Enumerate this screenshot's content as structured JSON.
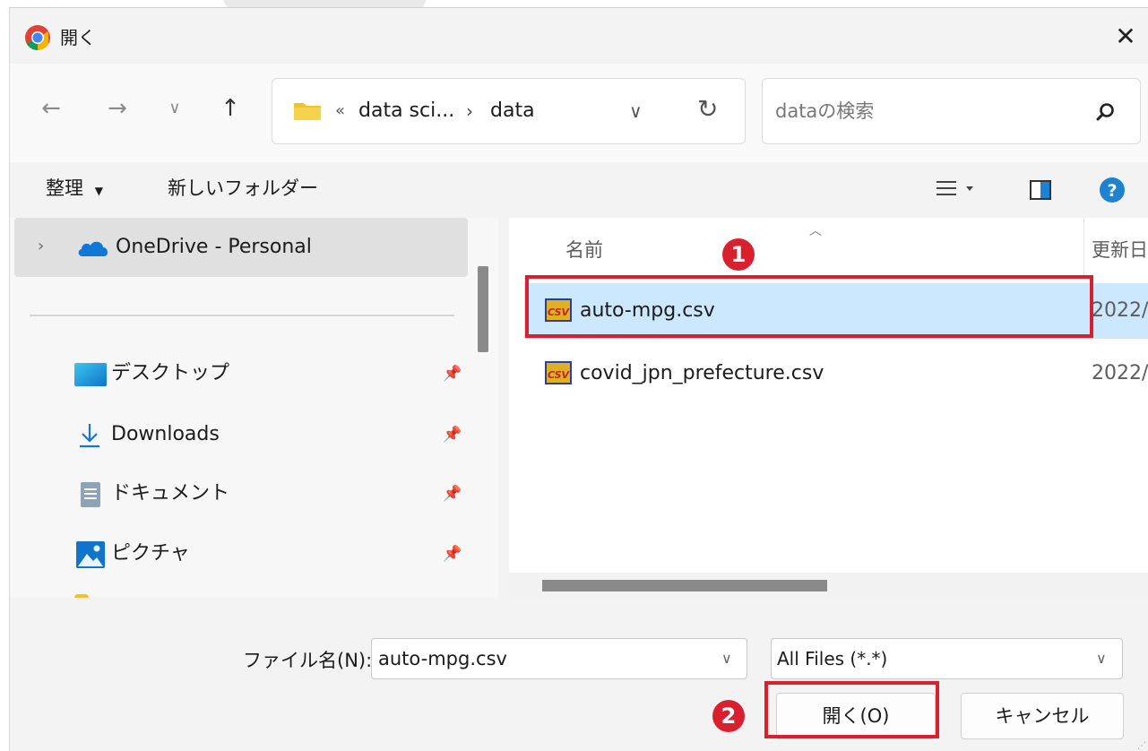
{
  "window": {
    "title": "開く"
  },
  "nav": {
    "path": [
      "data sci...",
      "data"
    ],
    "path_overflow": "«",
    "search_placeholder": "dataの検索"
  },
  "toolbar": {
    "organize": "整理",
    "new_folder": "新しいフォルダー"
  },
  "sidebar": {
    "onedrive": "OneDrive - Personal",
    "items": [
      {
        "label": "デスクトップ",
        "icon": "desktop-icon"
      },
      {
        "label": "Downloads",
        "icon": "download-icon"
      },
      {
        "label": "ドキュメント",
        "icon": "document-icon"
      },
      {
        "label": "ピクチャ",
        "icon": "pictures-icon"
      }
    ]
  },
  "file_list": {
    "columns": {
      "name": "名前",
      "modified": "更新日"
    },
    "rows": [
      {
        "name": "auto-mpg.csv",
        "date": "2022/",
        "selected": true
      },
      {
        "name": "covid_jpn_prefecture.csv",
        "date": "2022/",
        "selected": false
      }
    ]
  },
  "footer": {
    "filename_label": "ファイル名(N):",
    "filename_value": "auto-mpg.csv",
    "filter_value": "All Files (*.*)",
    "open_label": "開く(O)",
    "cancel_label": "キャンセル"
  },
  "annotations": {
    "badge1": "1",
    "badge2": "2",
    "color": "#d9202e"
  },
  "colors": {
    "selection": "#cce8ff",
    "accent": "#0067c0",
    "folder": "#f2c229"
  }
}
